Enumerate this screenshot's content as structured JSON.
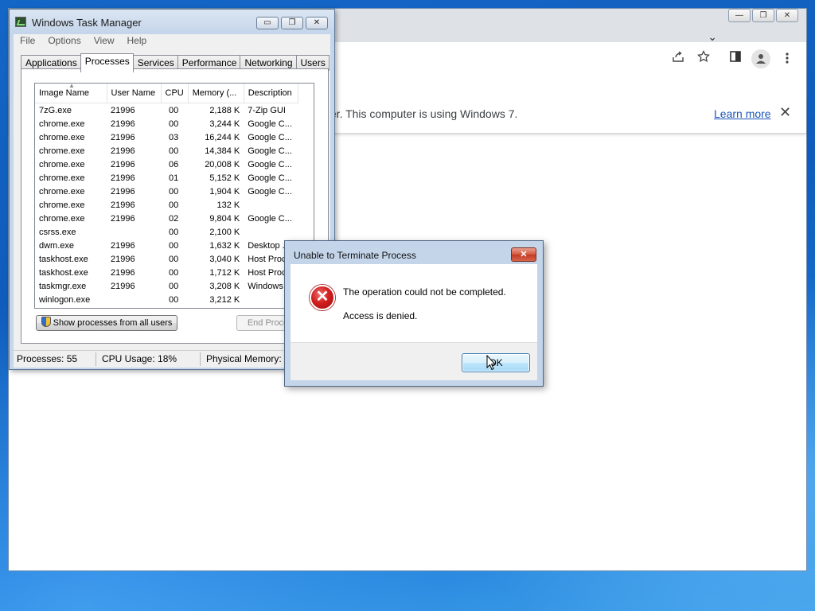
{
  "chrome": {
    "caption_buttons": [
      "—",
      "❐",
      "✕"
    ],
    "tab_chevron": "⌄",
    "toolbar_icons": [
      "share-icon",
      "star-icon",
      "side-panel-icon",
      "profile-icon",
      "menu-icon"
    ],
    "infobar": {
      "message": "ter. This computer is using Windows 7.",
      "link": "Learn more",
      "close": "✕"
    }
  },
  "taskmgr": {
    "title": "Windows Task Manager",
    "window_buttons": [
      "▭",
      "❐",
      "✕"
    ],
    "menu": [
      "File",
      "Options",
      "View",
      "Help"
    ],
    "tabs": [
      "Applications",
      "Processes",
      "Services",
      "Performance",
      "Networking",
      "Users"
    ],
    "active_tab": "Processes",
    "columns": [
      "Image Name",
      "User Name",
      "CPU",
      "Memory (...",
      "Description"
    ],
    "rows": [
      [
        "7zG.exe",
        "21996",
        "00",
        "2,188 K",
        "7-Zip GUI"
      ],
      [
        "chrome.exe",
        "21996",
        "00",
        "3,244 K",
        "Google C..."
      ],
      [
        "chrome.exe",
        "21996",
        "03",
        "16,244 K",
        "Google C..."
      ],
      [
        "chrome.exe",
        "21996",
        "00",
        "14,384 K",
        "Google C..."
      ],
      [
        "chrome.exe",
        "21996",
        "06",
        "20,008 K",
        "Google C..."
      ],
      [
        "chrome.exe",
        "21996",
        "01",
        "5,152 K",
        "Google C..."
      ],
      [
        "chrome.exe",
        "21996",
        "00",
        "1,904 K",
        "Google C..."
      ],
      [
        "chrome.exe",
        "21996",
        "00",
        "132 K",
        ""
      ],
      [
        "chrome.exe",
        "21996",
        "02",
        "9,804 K",
        "Google C..."
      ],
      [
        "csrss.exe",
        "",
        "00",
        "2,100 K",
        ""
      ],
      [
        "dwm.exe",
        "21996",
        "00",
        "1,632 K",
        "Desktop ..."
      ],
      [
        "taskhost.exe",
        "21996",
        "00",
        "3,040 K",
        "Host Proc..."
      ],
      [
        "taskhost.exe",
        "21996",
        "00",
        "1,712 K",
        "Host Proc..."
      ],
      [
        "taskmgr.exe",
        "21996",
        "00",
        "3,208 K",
        "Windows ..."
      ],
      [
        "winlogon.exe",
        "",
        "00",
        "3,212 K",
        ""
      ]
    ],
    "show_all_button": "Show processes from all users",
    "end_process_button": "End Process",
    "status": {
      "processes": "Processes: 55",
      "cpu": "CPU Usage: 18%",
      "memory": "Physical Memory: 2"
    }
  },
  "dialog": {
    "title": "Unable to Terminate Process",
    "close": "✕",
    "message": "The operation could not be completed.",
    "detail": "Access is denied.",
    "ok_button": "OK",
    "error_symbol": "✕"
  }
}
